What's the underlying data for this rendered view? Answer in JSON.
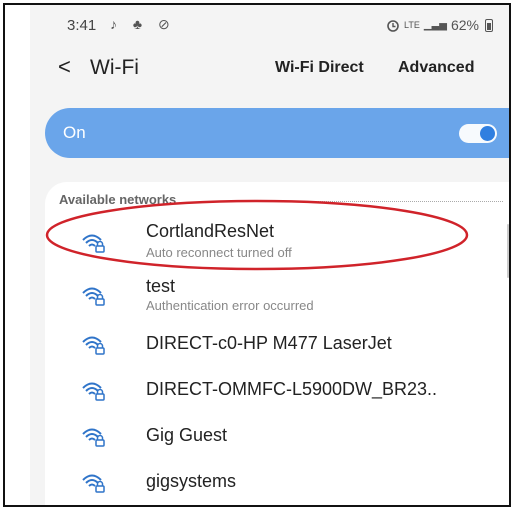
{
  "status_bar": {
    "time": "3:41",
    "left_icons": "♪ ♣ ⊘",
    "lte_label": "LTE",
    "signal_glyph": "▁▃▅",
    "battery": "62%"
  },
  "header": {
    "back_glyph": "<",
    "title": "Wi-Fi",
    "wifi_direct_label": "Wi-Fi Direct",
    "advanced_label": "Advanced"
  },
  "toggle_bar": {
    "label": "On",
    "state": true,
    "accent_color": "#6aa5ea",
    "knob_color": "#2d7de0"
  },
  "networks_section": {
    "header": "Available networks",
    "items": [
      {
        "name": "CortlandResNet",
        "subtitle": "Auto reconnect turned off",
        "icon": "wifi-locked-icon",
        "highlighted": true
      },
      {
        "name": "test",
        "subtitle": "Authentication error occurred",
        "icon": "wifi-locked-icon"
      },
      {
        "name": "DIRECT-c0-HP M477 LaserJet",
        "subtitle": "",
        "icon": "wifi-locked-icon"
      },
      {
        "name": "DIRECT-OMMFC-L5900DW_BR23..",
        "subtitle": "",
        "icon": "wifi-locked-icon"
      },
      {
        "name": "Gig Guest",
        "subtitle": "",
        "icon": "wifi-locked-icon"
      },
      {
        "name": "gigsystems",
        "subtitle": "",
        "icon": "wifi-locked-icon"
      }
    ]
  },
  "annotation": {
    "type": "red-ellipse",
    "color": "#d0232a",
    "target": "CortlandResNet"
  }
}
